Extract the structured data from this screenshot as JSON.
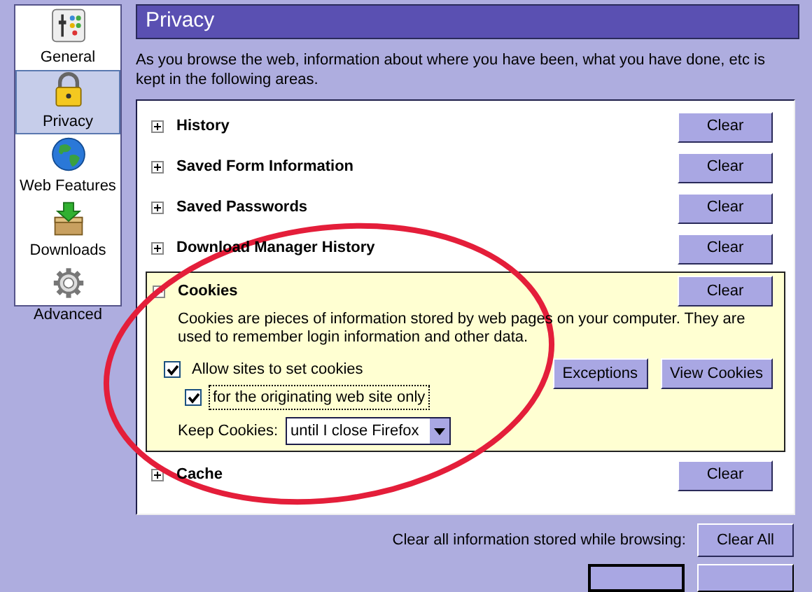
{
  "sidebar": {
    "items": [
      {
        "label": "General",
        "kind": "general",
        "selected": false
      },
      {
        "label": "Privacy",
        "kind": "privacy",
        "selected": true
      },
      {
        "label": "Web Features",
        "kind": "web",
        "selected": false
      },
      {
        "label": "Downloads",
        "kind": "downloads",
        "selected": false
      },
      {
        "label": "Advanced",
        "kind": "advanced",
        "selected": false
      }
    ]
  },
  "panel": {
    "title": "Privacy",
    "description": "As you browse the web, information about where you have been, what you have done, etc is kept in the following areas.",
    "sections": [
      {
        "title": "History",
        "expanded": false,
        "button": "Clear"
      },
      {
        "title": "Saved Form Information",
        "expanded": false,
        "button": "Clear"
      },
      {
        "title": "Saved Passwords",
        "expanded": false,
        "button": "Clear"
      },
      {
        "title": "Download Manager History",
        "expanded": false,
        "button": "Clear"
      },
      {
        "title": "Cookies",
        "expanded": true,
        "button": "Clear",
        "description": "Cookies are pieces of information stored by web pages on your computer. They are used to remember login information and other data.",
        "options": [
          {
            "label": "Allow sites to set cookies",
            "checked": true,
            "focused": false,
            "children": [
              {
                "label": "for the originating web site only",
                "checked": true,
                "focused": true
              }
            ]
          }
        ],
        "buttons": [
          "Exceptions",
          "View Cookies"
        ],
        "keep": {
          "label": "Keep Cookies:",
          "value": "until I close Firefox"
        }
      },
      {
        "title": "Cache",
        "expanded": false,
        "button": "Clear"
      }
    ]
  },
  "footer": {
    "text": "Clear all information stored while browsing:",
    "button": "Clear All"
  }
}
